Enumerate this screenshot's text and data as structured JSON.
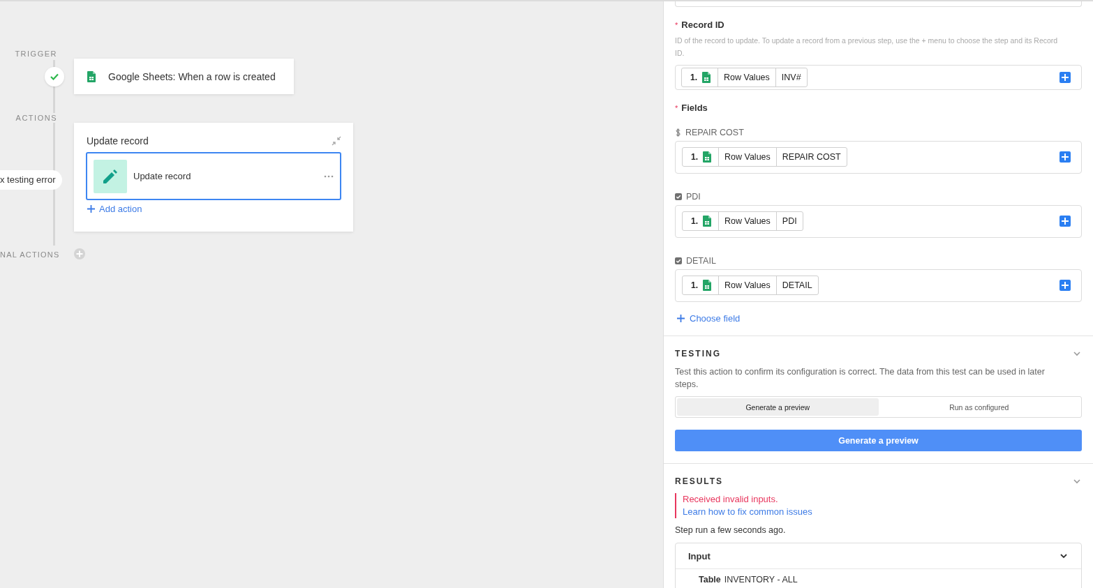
{
  "canvas": {
    "trigger_label": "TRIGGER",
    "actions_label": "ACTIONS",
    "final_label": "NAL ACTIONS",
    "trigger": {
      "title": "Google Sheets: When a row is created",
      "completed": true
    },
    "action_group": {
      "title": "Update record",
      "steps": [
        {
          "title": "Update record",
          "selected": true
        }
      ],
      "add_action": "Add action"
    },
    "error_badge": "x testing error"
  },
  "panel": {
    "record_id": {
      "label": "Record ID",
      "required_mark": "*",
      "help": "ID of the record to update. To update a record from a previous step, use the + menu to choose the step and its Record ID.",
      "tokens": [
        {
          "step": "1.",
          "source": "Row Values",
          "field": "INV#"
        }
      ]
    },
    "fields": {
      "label": "Fields",
      "required_mark": "*",
      "items": [
        {
          "kind": "currency",
          "label": "REPAIR COST",
          "tokens": [
            {
              "step": "1.",
              "source": "Row Values",
              "field": "REPAIR COST"
            }
          ]
        },
        {
          "kind": "boolean",
          "label": "PDI",
          "tokens": [
            {
              "step": "1.",
              "source": "Row Values",
              "field": "PDI"
            }
          ]
        },
        {
          "kind": "boolean",
          "label": "DETAIL",
          "tokens": [
            {
              "step": "1.",
              "source": "Row Values",
              "field": "DETAIL"
            }
          ]
        }
      ],
      "choose_field": "Choose field"
    },
    "testing": {
      "title": "TESTING",
      "expanded": true,
      "description": "Test this action to confirm its configuration is correct. The data from this test can be used in later steps.",
      "modes": [
        {
          "label": "Generate a preview",
          "selected": true
        },
        {
          "label": "Run as configured",
          "selected": false
        }
      ],
      "button": "Generate a preview"
    },
    "results": {
      "title": "RESULTS",
      "expanded": true,
      "error": "Received invalid inputs.",
      "help_link": "Learn how to fix common issues",
      "status": "Step run a few seconds ago.",
      "input": {
        "title": "Input",
        "expanded": true,
        "rows": [
          {
            "key": "Table",
            "value": "INVENTORY - ALL"
          }
        ]
      }
    }
  }
}
